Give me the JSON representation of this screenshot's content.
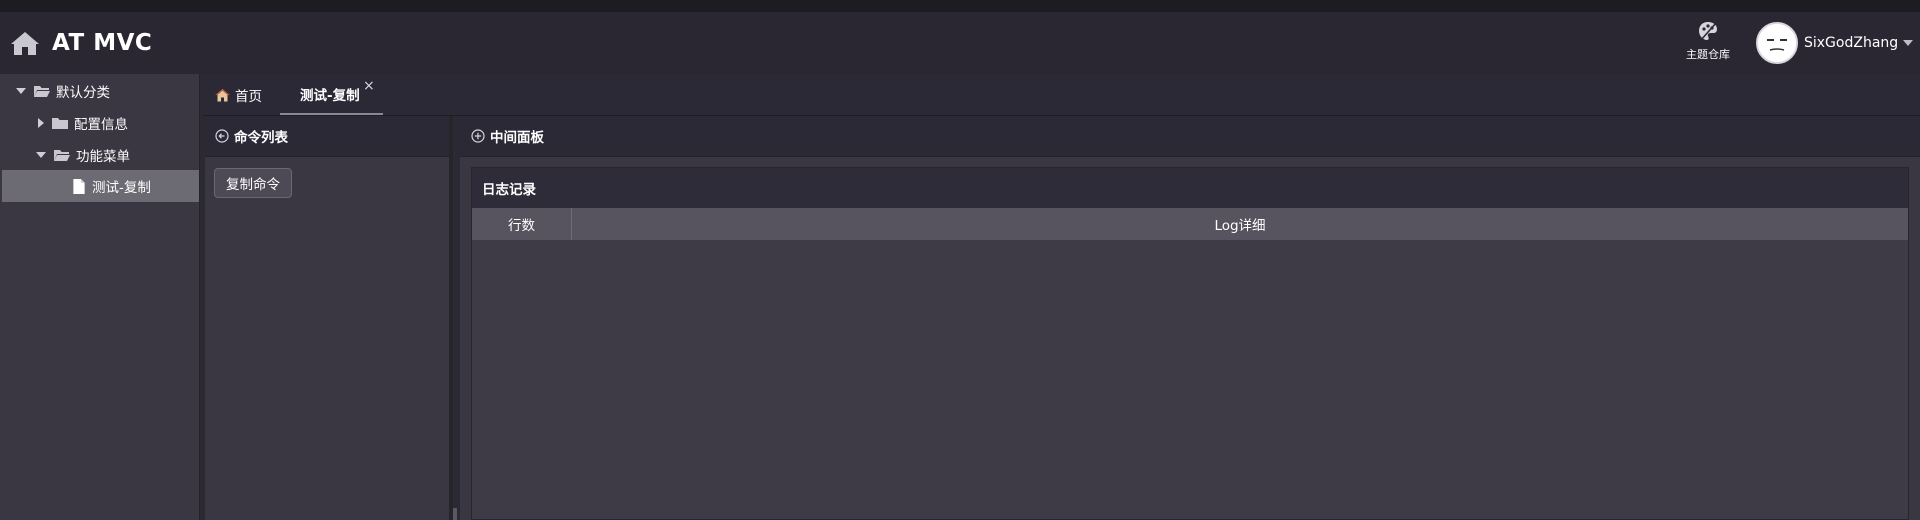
{
  "header": {
    "title": "AT MVC",
    "theme_label": "主题仓库",
    "username": "SixGodZhang"
  },
  "sidebar": {
    "items": [
      {
        "label": "默认分类",
        "expanded": true,
        "icon": "folder-open-icon"
      },
      {
        "label": "配置信息",
        "expanded": false,
        "icon": "folder-icon"
      },
      {
        "label": "功能菜单",
        "expanded": true,
        "icon": "folder-open-icon"
      },
      {
        "label": "测试-复制",
        "selected": true,
        "icon": "file-icon"
      }
    ]
  },
  "tabs": {
    "home_label": "首页",
    "active_label": "测试-复制",
    "close_glyph": "×"
  },
  "left_panel": {
    "title": "命令列表",
    "button_label": "复制命令"
  },
  "mid_panel": {
    "title": "中间面板",
    "log": {
      "title": "日志记录",
      "columns": [
        "行数",
        "Log详细"
      ]
    }
  },
  "colors": {
    "background": "#2b2a33",
    "header": "#2a2733",
    "panel": "#3a3742",
    "table_header": "#57535f",
    "selected_item": "#6c6a73"
  }
}
